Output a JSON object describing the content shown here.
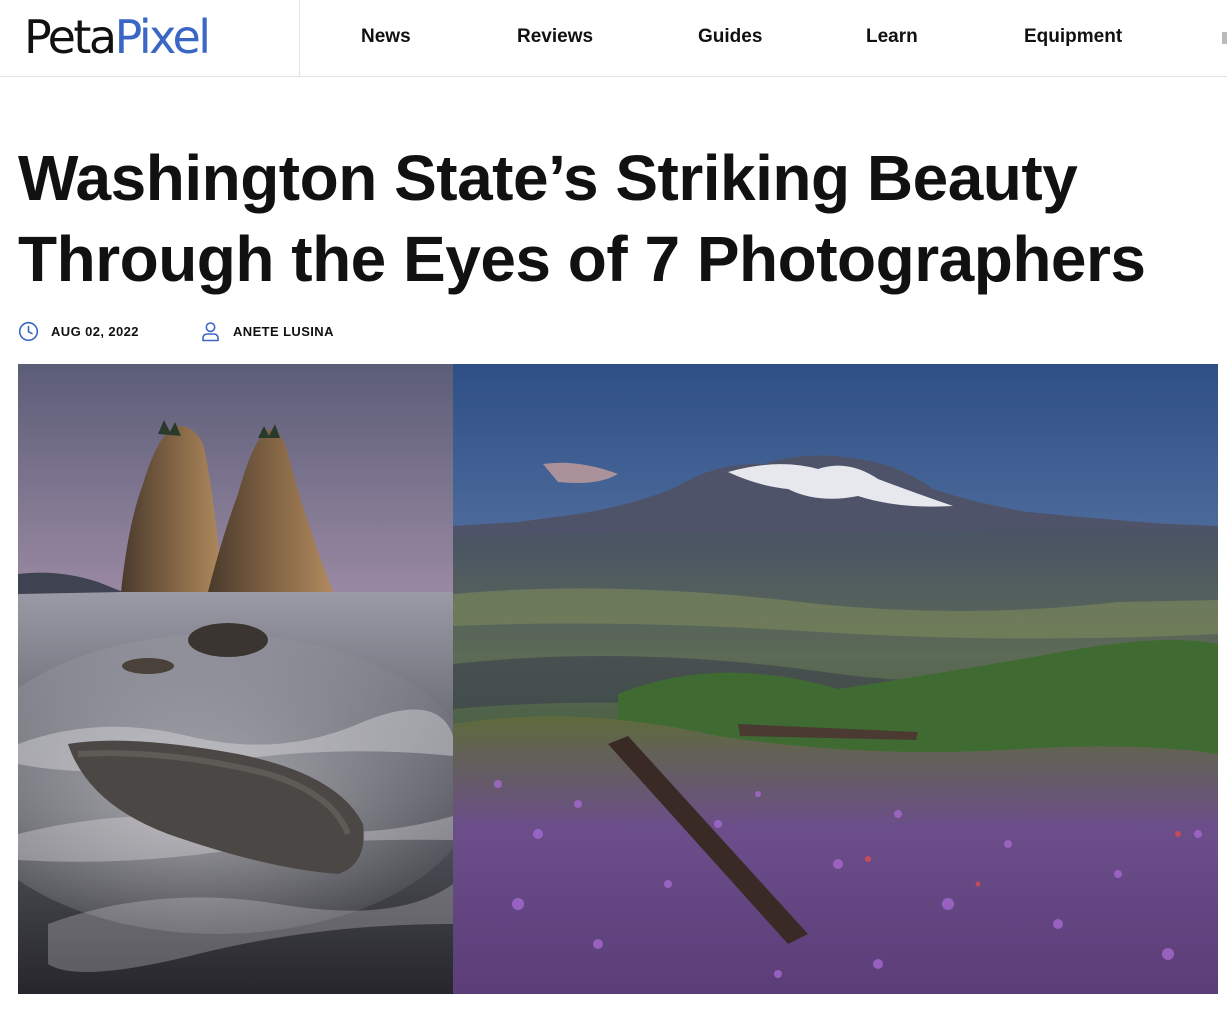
{
  "header": {
    "logo": {
      "peta": "Peta",
      "pixel": "Pixel"
    },
    "nav": [
      "News",
      "Reviews",
      "Guides",
      "Learn",
      "Equipment"
    ]
  },
  "article": {
    "title_line1": "Washington State’s Striking Beauty",
    "title_line2": "Through the Eyes of 7 Photographers",
    "date": "AUG 02, 2022",
    "author": "ANETE LUSINA"
  },
  "colors": {
    "brand_blue": "#3a66c4",
    "text": "#111111",
    "divider": "#e2e2e2"
  },
  "icons": {
    "date": "clock-icon",
    "author": "user-icon"
  }
}
